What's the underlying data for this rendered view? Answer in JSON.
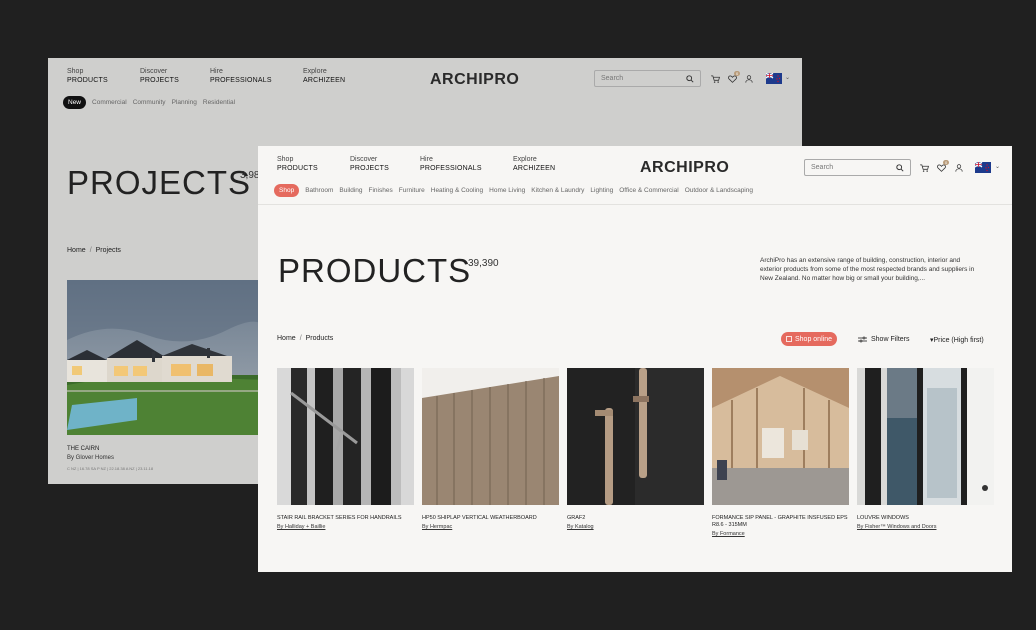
{
  "colors": {
    "accent": "#e56a5e",
    "dark_pill": "#111111"
  },
  "back": {
    "nav": [
      {
        "top": "Shop",
        "bottom": "PRODUCTS"
      },
      {
        "top": "Discover",
        "bottom": "PROJECTS"
      },
      {
        "top": "Hire",
        "bottom": "PROFESSIONALS"
      },
      {
        "top": "Explore",
        "bottom": "ARCHIZEEN"
      }
    ],
    "logo": "ARCHIPRO",
    "search_placeholder": "Search",
    "wishlist_badge": "0",
    "categories": [
      "New",
      "Commercial",
      "Community",
      "Planning",
      "Residential"
    ],
    "title": "PROJECTS",
    "count": "3,98",
    "breadcrumb": [
      "Home",
      "Projects"
    ],
    "project": {
      "title": "THE CAIRN",
      "by": "By Glover Homes",
      "awards": "C NZ | 16.78 SA  P NZ | 22.18.38  A NZ | 23.11.18"
    }
  },
  "front": {
    "nav": [
      {
        "top": "Shop",
        "bottom": "PRODUCTS"
      },
      {
        "top": "Discover",
        "bottom": "PROJECTS"
      },
      {
        "top": "Hire",
        "bottom": "PROFESSIONALS"
      },
      {
        "top": "Explore",
        "bottom": "ARCHIZEEN"
      }
    ],
    "logo": "ARCHIPRO",
    "search_placeholder": "Search",
    "wishlist_badge": "0",
    "categories": [
      "Shop",
      "Bathroom",
      "Building",
      "Finishes",
      "Furniture",
      "Heating & Cooling",
      "Home Living",
      "Kitchen & Laundry",
      "Lighting",
      "Office & Commercial",
      "Outdoor & Landscaping"
    ],
    "title": "PRODUCTS",
    "count": "39,390",
    "description": "ArchiPro has an extensive range of building, construction, interior and exterior products from some of the most respected brands and suppliers in New Zealand. No matter how big or small your building,...",
    "breadcrumb": [
      "Home",
      "Products"
    ],
    "shop_online": "Shop online",
    "show_filters": "Show Filters",
    "sort": "▾Price (High first)",
    "products": [
      {
        "name": "STAIR RAIL BRACKET SERIES FOR HANDRAILS",
        "brand": "By Halliday + Baillie"
      },
      {
        "name": "HP50 SHIPLAP VERTICAL WEATHERBOARD",
        "brand": "By Hermpac"
      },
      {
        "name": "GRAF2",
        "brand": "By Katalog"
      },
      {
        "name": "FORMANCE SIP PANEL - GRAPHITE INSFUSED EPS R8.6 - 315MM",
        "brand": "By Formance"
      },
      {
        "name": "LOUVRE WINDOWS",
        "brand": "By Fisher™ Windows and Doors"
      }
    ]
  }
}
